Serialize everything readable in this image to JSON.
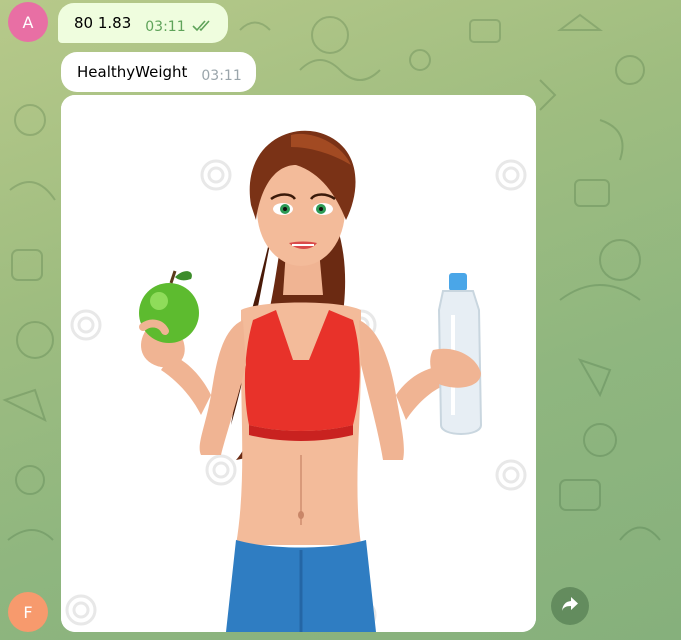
{
  "chat": {
    "sender_avatar_letter": "A",
    "outgoing_message": {
      "text": "80 1.83",
      "time": "03:11",
      "status_icon": "double-check-icon"
    },
    "incoming_message": {
      "text": "HealthyWeight",
      "time": "03:11"
    },
    "photo_message": {
      "watermark": "dreamstime",
      "subject": "woman holding green apple and water bottle"
    },
    "bot_avatar_letter": "F",
    "forward_icon": "forward-arrow-icon",
    "colors": {
      "outgoing_bubble": "#effdde",
      "incoming_bubble": "#ffffff",
      "accent_check": "#5fa35a",
      "avatar_a": "#e86fa4",
      "avatar_f": "#f79a6d"
    }
  }
}
